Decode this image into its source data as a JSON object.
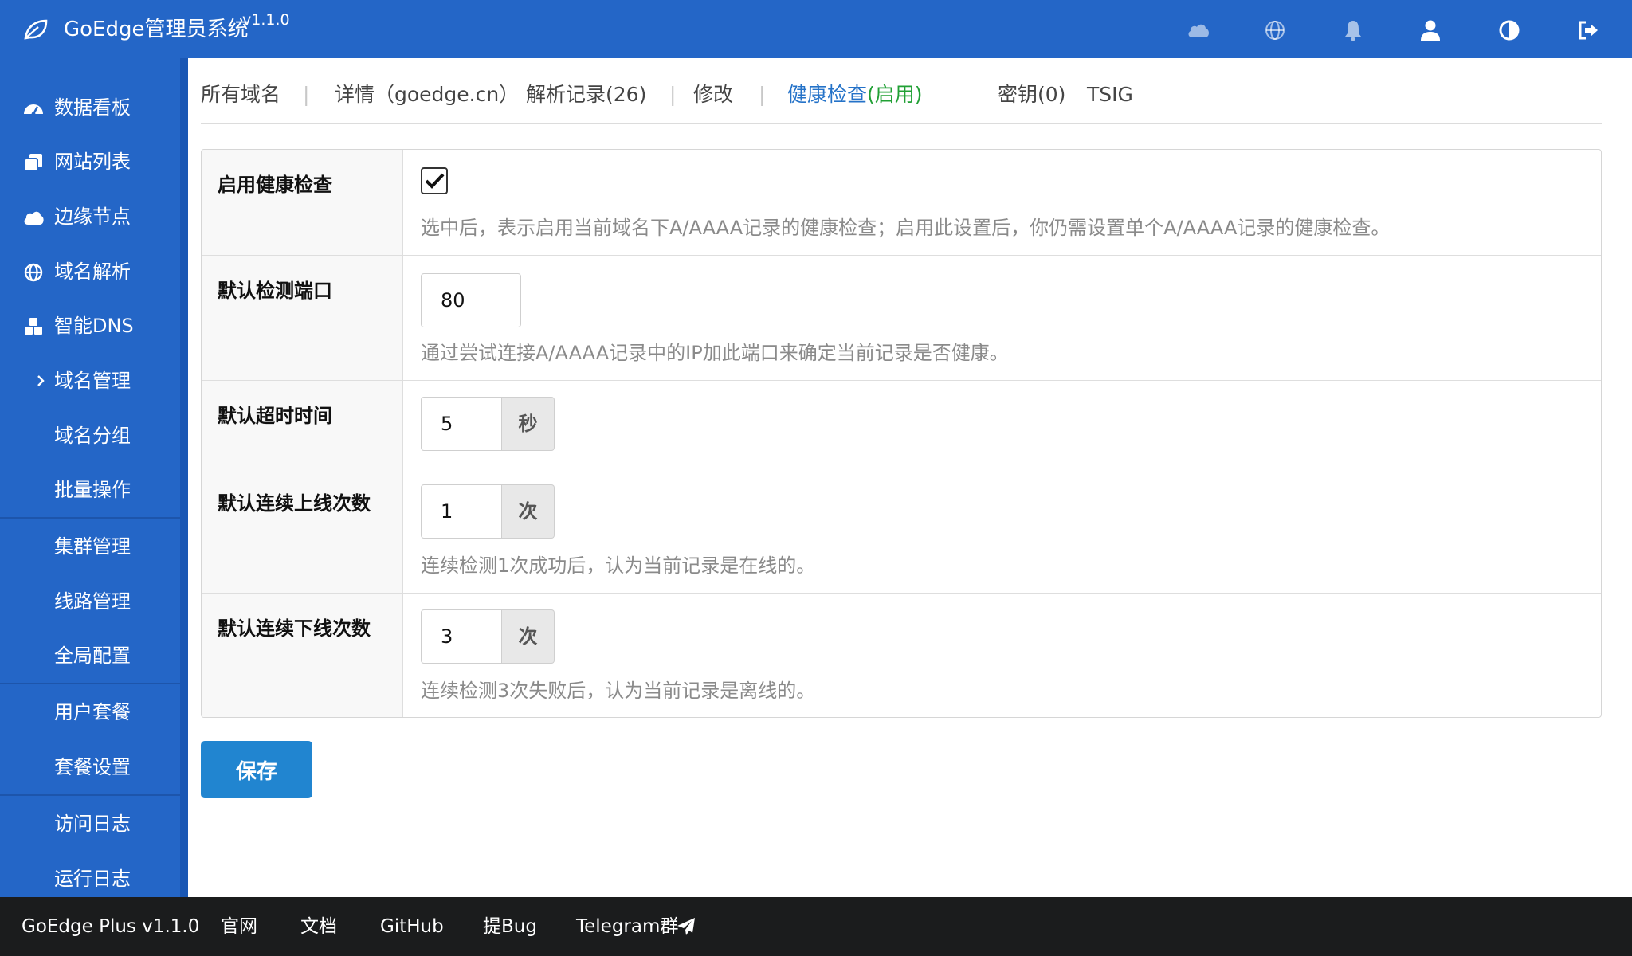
{
  "header": {
    "title": "GoEdge管理员系统",
    "version": "v1.1.0",
    "icons": [
      "cloud-icon",
      "globe-icon",
      "bell-icon",
      "user-icon",
      "contrast-icon",
      "logout-icon"
    ]
  },
  "sidebar": {
    "items": [
      {
        "label": "数据看板",
        "icon": "dashboard-icon"
      },
      {
        "label": "网站列表",
        "icon": "copy-icon"
      },
      {
        "label": "边缘节点",
        "icon": "cloud-icon"
      },
      {
        "label": "域名解析",
        "icon": "globe-icon"
      },
      {
        "label": "智能DNS",
        "icon": "cubes-icon"
      },
      {
        "label": "域名管理",
        "icon": "chevron-right-icon"
      },
      {
        "label": "域名分组"
      },
      {
        "label": "批量操作"
      },
      {
        "label": "集群管理"
      },
      {
        "label": "线路管理"
      },
      {
        "label": "全局配置"
      },
      {
        "label": "用户套餐"
      },
      {
        "label": "套餐设置"
      },
      {
        "label": "访问日志"
      },
      {
        "label": "运行日志"
      }
    ]
  },
  "tabs": {
    "all_domains": "所有域名",
    "details": "详情（goedge.cn）",
    "records": "解析记录(26)",
    "modify": "修改",
    "health_check": "健康检查",
    "health_status": "(启用)",
    "keys": "密钥(0)",
    "tsig": "TSIG",
    "separator": "|"
  },
  "form": {
    "enable": {
      "label": "启用健康检查",
      "checked": true,
      "help": "选中后，表示启用当前域名下A/AAAA记录的健康检查；启用此设置后，你仍需设置单个A/AAAA记录的健康检查。"
    },
    "port": {
      "label": "默认检测端口",
      "value": "80",
      "help": "通过尝试连接A/AAAA记录中的IP加此端口来确定当前记录是否健康。"
    },
    "timeout": {
      "label": "默认超时时间",
      "value": "5",
      "unit": "秒"
    },
    "up_count": {
      "label": "默认连续上线次数",
      "value": "1",
      "unit": "次",
      "help": "连续检测1次成功后，认为当前记录是在线的。"
    },
    "down_count": {
      "label": "默认连续下线次数",
      "value": "3",
      "unit": "次",
      "help": "连续检测3次失败后，认为当前记录是离线的。"
    },
    "save_label": "保存"
  },
  "footer": {
    "product": "GoEdge Plus v1.1.0",
    "website": "官网",
    "docs": "文档",
    "github": "GitHub",
    "bug": "提Bug",
    "telegram": "Telegram群"
  },
  "colors": {
    "brand_blue": "#2466c7",
    "active_tab": "#2472c8",
    "enabled_green": "#21a035",
    "save_button": "#2185d0",
    "footer_bg": "#1b1c1d"
  }
}
